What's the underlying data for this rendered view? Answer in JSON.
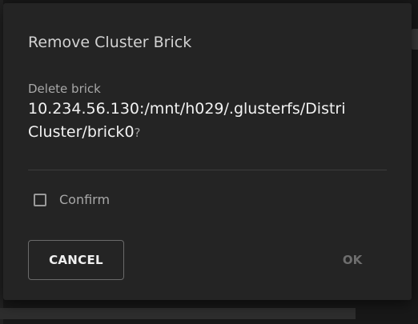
{
  "dialog": {
    "title": "Remove Cluster Brick",
    "message_prefix": "Delete brick",
    "brick_path_line1": "10.234.56.130:/mnt/h029/.glusterfs/Distri",
    "brick_path_line2": "Cluster/brick0",
    "question_mark": "?",
    "confirm_label": "Confirm",
    "confirm_checked": false,
    "cancel_label": "CANCEL",
    "ok_label": "OK",
    "ok_enabled": false
  },
  "colors": {
    "dialog_background": "#242424",
    "backdrop": "#181818",
    "title_text": "#d2d2d2",
    "path_text": "#f2f2f2",
    "muted_text": "#a8a8a8",
    "disabled_text": "#6e6e6e"
  },
  "icons": {
    "checkbox": "checkbox-unchecked-icon"
  }
}
